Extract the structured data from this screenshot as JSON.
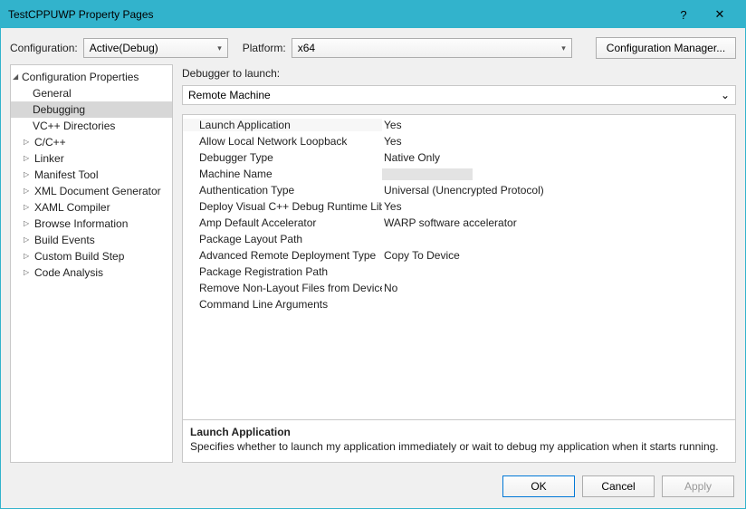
{
  "window": {
    "title": "TestCPPUWP Property Pages"
  },
  "toolbar": {
    "config_label": "Configuration:",
    "config_value": "Active(Debug)",
    "platform_label": "Platform:",
    "platform_value": "x64",
    "config_manager": "Configuration Manager..."
  },
  "tree": {
    "root": "Configuration Properties",
    "items": [
      {
        "label": "General",
        "expandable": false
      },
      {
        "label": "Debugging",
        "expandable": false,
        "selected": true
      },
      {
        "label": "VC++ Directories",
        "expandable": false
      },
      {
        "label": "C/C++",
        "expandable": true
      },
      {
        "label": "Linker",
        "expandable": true
      },
      {
        "label": "Manifest Tool",
        "expandable": true
      },
      {
        "label": "XML Document Generator",
        "expandable": true
      },
      {
        "label": "XAML Compiler",
        "expandable": true
      },
      {
        "label": "Browse Information",
        "expandable": true
      },
      {
        "label": "Build Events",
        "expandable": true
      },
      {
        "label": "Custom Build Step",
        "expandable": true
      },
      {
        "label": "Code Analysis",
        "expandable": true
      }
    ]
  },
  "main": {
    "launch_label": "Debugger to launch:",
    "launch_value": "Remote Machine",
    "props": [
      {
        "name": "Launch Application",
        "value": "Yes"
      },
      {
        "name": "Allow Local Network Loopback",
        "value": "Yes"
      },
      {
        "name": "Debugger Type",
        "value": "Native Only"
      },
      {
        "name": "Machine Name",
        "value": ""
      },
      {
        "name": "Authentication Type",
        "value": "Universal (Unencrypted Protocol)"
      },
      {
        "name": "Deploy Visual C++ Debug Runtime Libraries",
        "value": "Yes"
      },
      {
        "name": "Amp Default Accelerator",
        "value": "WARP software accelerator"
      },
      {
        "name": "Package Layout Path",
        "value": ""
      },
      {
        "name": "Advanced Remote Deployment Type",
        "value": "Copy To Device"
      },
      {
        "name": "Package Registration Path",
        "value": ""
      },
      {
        "name": "Remove Non-Layout Files from Device",
        "value": "No"
      },
      {
        "name": "Command Line Arguments",
        "value": ""
      }
    ],
    "desc_title": "Launch Application",
    "desc_body": "Specifies whether to launch my application immediately or wait to debug my application when it starts running."
  },
  "footer": {
    "ok": "OK",
    "cancel": "Cancel",
    "apply": "Apply"
  }
}
